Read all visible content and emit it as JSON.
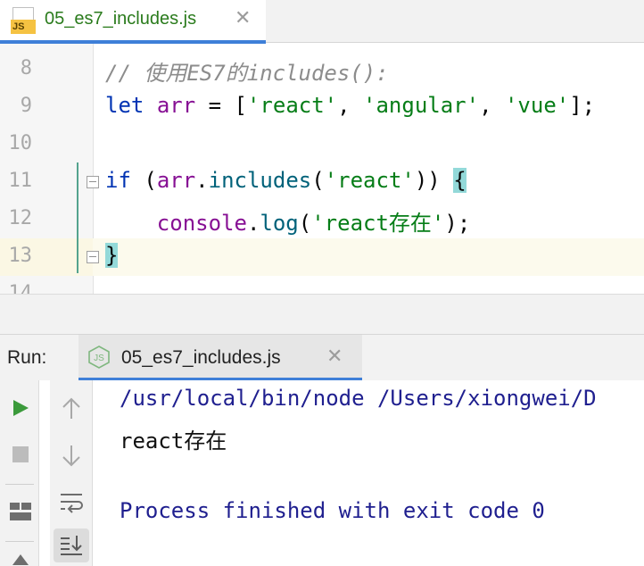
{
  "editor": {
    "tab": {
      "filename": "05_es7_includes.js",
      "icon": "js-file-icon",
      "close": "✕"
    },
    "lines": [
      {
        "num": "8",
        "tokens": [
          {
            "t": "// 使用ES7的includes():",
            "c": "c"
          }
        ]
      },
      {
        "num": "9",
        "tokens": [
          {
            "t": "let",
            "c": "k"
          },
          {
            "t": " "
          },
          {
            "t": "arr",
            "c": "v"
          },
          {
            "t": " = ["
          },
          {
            "t": "'react'",
            "c": "s"
          },
          {
            "t": ", "
          },
          {
            "t": "'angular'",
            "c": "s"
          },
          {
            "t": ", "
          },
          {
            "t": "'vue'",
            "c": "s"
          },
          {
            "t": "];"
          }
        ]
      },
      {
        "num": "10",
        "tokens": []
      },
      {
        "num": "11",
        "tokens": [
          {
            "t": "if",
            "c": "k"
          },
          {
            "t": " ("
          },
          {
            "t": "arr",
            "c": "v"
          },
          {
            "t": "."
          },
          {
            "t": "includes",
            "c": "f"
          },
          {
            "t": "("
          },
          {
            "t": "'react'",
            "c": "s"
          },
          {
            "t": ")) "
          },
          {
            "t": "{",
            "c": "brace-hl"
          }
        ]
      },
      {
        "num": "12",
        "tokens": [
          {
            "t": "    "
          },
          {
            "t": "console",
            "c": "v"
          },
          {
            "t": "."
          },
          {
            "t": "log",
            "c": "f"
          },
          {
            "t": "("
          },
          {
            "t": "'react存在'",
            "c": "s"
          },
          {
            "t": ");"
          }
        ]
      },
      {
        "num": "13",
        "tokens": [
          {
            "t": "}",
            "c": "brace-hl"
          }
        ],
        "current": true
      },
      {
        "num": "14",
        "tokens": []
      }
    ]
  },
  "run": {
    "title": "Run:",
    "tab": {
      "filename": "05_es7_includes.js",
      "icon": "nodejs-icon",
      "close": "✕"
    },
    "toolbar_left": [
      "run-icon",
      "stop-icon",
      "layout-icon"
    ],
    "toolbar_right": [
      "up-arrow-icon",
      "down-arrow-icon",
      "soft-wrap-icon",
      "scroll-to-end-icon"
    ],
    "console": [
      {
        "text": "/usr/local/bin/node /Users/xiongwei/D",
        "kind": "cmd"
      },
      {
        "text": "react存在",
        "kind": "out"
      },
      {
        "text": "",
        "kind": "out"
      },
      {
        "text": "Process finished with exit code 0",
        "kind": "exit"
      }
    ],
    "colors": {
      "accent": "#3e7fd8",
      "run_green": "#3b9a3b"
    }
  }
}
